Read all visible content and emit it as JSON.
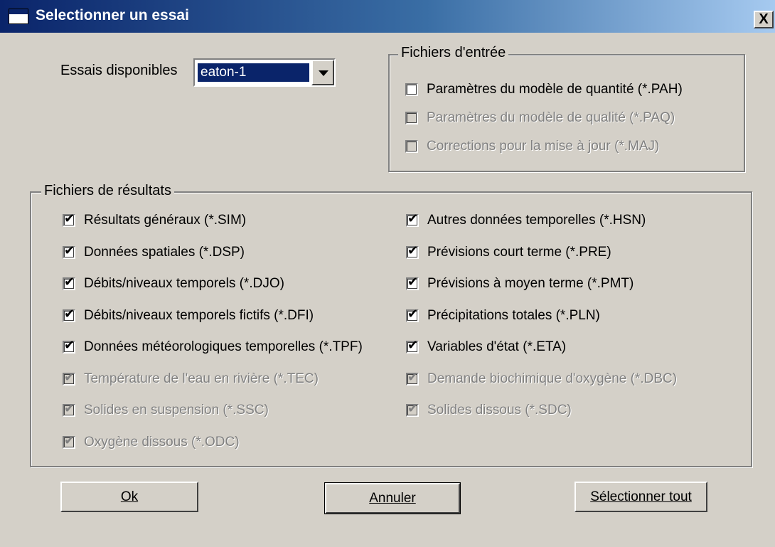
{
  "window": {
    "title": "Selectionner un essai",
    "close_label": "X"
  },
  "essais": {
    "label": "Essais disponibles",
    "selected": "eaton-1"
  },
  "input_group": {
    "title": "Fichiers d'entrée",
    "items": [
      {
        "label": "Paramètres du modèle de quantité (*.PAH)",
        "checked": false,
        "enabled": true
      },
      {
        "label": "Paramètres du modèle de qualité (*.PAQ)",
        "checked": false,
        "enabled": false
      },
      {
        "label": "Corrections pour la mise à jour (*.MAJ)",
        "checked": false,
        "enabled": false
      }
    ]
  },
  "results_group": {
    "title": "Fichiers de résultats",
    "left": [
      {
        "label": "Résultats généraux (*.SIM)",
        "checked": true,
        "enabled": true
      },
      {
        "label": "Données spatiales (*.DSP)",
        "checked": true,
        "enabled": true
      },
      {
        "label": "Débits/niveaux temporels (*.DJO)",
        "checked": true,
        "enabled": true
      },
      {
        "label": "Débits/niveaux temporels fictifs (*.DFI)",
        "checked": true,
        "enabled": true
      },
      {
        "label": "Données météorologiques temporelles (*.TPF)",
        "checked": true,
        "enabled": true
      },
      {
        "label": "Température de l'eau en rivière (*.TEC)",
        "checked": true,
        "enabled": false
      },
      {
        "label": "Solides en suspension (*.SSC)",
        "checked": true,
        "enabled": false
      },
      {
        "label": "Oxygène dissous (*.ODC)",
        "checked": true,
        "enabled": false
      }
    ],
    "right": [
      {
        "label": "Autres données temporelles (*.HSN)",
        "checked": true,
        "enabled": true
      },
      {
        "label": "Prévisions court terme (*.PRE)",
        "checked": true,
        "enabled": true
      },
      {
        "label": "Prévisions à moyen terme (*.PMT)",
        "checked": true,
        "enabled": true
      },
      {
        "label": "Précipitations totales (*.PLN)",
        "checked": true,
        "enabled": true
      },
      {
        "label": "Variables d'état  (*.ETA)",
        "checked": true,
        "enabled": true
      },
      {
        "label": "Demande biochimique d'oxygène (*.DBC)",
        "checked": true,
        "enabled": false
      },
      {
        "label": "Solides dissous (*.SDC)",
        "checked": true,
        "enabled": false
      }
    ]
  },
  "buttons": {
    "ok": "Ok",
    "cancel": "Annuler",
    "select_all": "Sélectionner tout"
  },
  "colors": {
    "face": "#d4d0c8",
    "title_start": "#0a246a",
    "title_end": "#a6caf0",
    "disabled_text": "#808080"
  }
}
